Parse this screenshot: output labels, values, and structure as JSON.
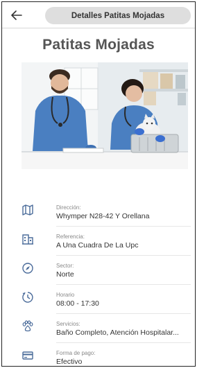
{
  "header": {
    "back_icon": "arrow-left-icon",
    "title": "Detalles Patitas Mojadas"
  },
  "page": {
    "title": "Patitas Mojadas"
  },
  "details": [
    {
      "icon": "map-icon",
      "label": "Dirección:",
      "value": "Whymper N28-42 Y Orellana"
    },
    {
      "icon": "building-icon",
      "label": "Referencia:",
      "value": "A Una Cuadra De La Upc"
    },
    {
      "icon": "compass-icon",
      "label": "Sector:",
      "value": "Norte"
    },
    {
      "icon": "clock-icon",
      "label": "Horario",
      "value": "08:00 - 17:30"
    },
    {
      "icon": "pets-icon",
      "label": "Servicios:",
      "value": "Baño Completo, Atención Hospitalar..."
    },
    {
      "icon": "credit-card-icon",
      "label": "Forma de pago:",
      "value": "Efectivo"
    }
  ],
  "colors": {
    "icon": "#4a6b9a",
    "pill": "#dedede",
    "scrubs": "#4a7fc1"
  }
}
